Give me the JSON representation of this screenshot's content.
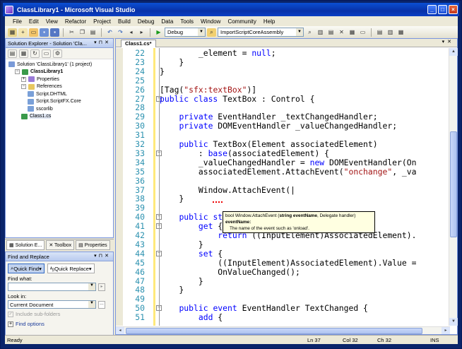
{
  "window": {
    "title": "ClassLibrary1 - Microsoft Visual Studio"
  },
  "menu": [
    "File",
    "Edit",
    "View",
    "Refactor",
    "Project",
    "Build",
    "Debug",
    "Data",
    "Tools",
    "Window",
    "Community",
    "Help"
  ],
  "toolbar": {
    "config": "Debug",
    "project": "ImportScriptCoreAssembly"
  },
  "solution_explorer": {
    "title": "Solution Explorer - Solution 'Cla...",
    "nodes": [
      {
        "label": "Solution 'ClassLibrary1' (1 project)",
        "indent": 0
      },
      {
        "label": "ClassLibrary1",
        "indent": 1,
        "bold": true
      },
      {
        "label": "Properties",
        "indent": 2
      },
      {
        "label": "References",
        "indent": 2
      },
      {
        "label": "Script.DHTML",
        "indent": 3
      },
      {
        "label": "Script.ScriptFX.Core",
        "indent": 3
      },
      {
        "label": "sscorlib",
        "indent": 3
      },
      {
        "label": "Class1.cs",
        "indent": 2
      }
    ]
  },
  "pane_tabs": {
    "tab1": "Solution E...",
    "tab2": "Toolbox",
    "tab3": "Properties"
  },
  "find_replace": {
    "title": "Find and Replace",
    "quick_find": "Quick Find",
    "quick_replace": "Quick Replace",
    "find_what_label": "Find what:",
    "find_what_value": "",
    "look_in_label": "Look in:",
    "look_in_value": "Current Document",
    "include_sub": "Include sub-folders",
    "find_options": "Find options"
  },
  "editor": {
    "tab_label": "Class1.cs*",
    "lines": [
      {
        "n": "22",
        "html": "        _element = <span class=\"kw\">null</span>;"
      },
      {
        "n": "23",
        "html": "    }"
      },
      {
        "n": "24",
        "html": "}"
      },
      {
        "n": "25",
        "html": ""
      },
      {
        "n": "26",
        "html": "[Tag(<span class=\"st\">\"sfx:textBox\"</span>)]"
      },
      {
        "n": "27",
        "html": "<span class=\"kw\">public class</span> TextBox : Control {"
      },
      {
        "n": "28",
        "html": ""
      },
      {
        "n": "29",
        "html": "    <span class=\"kw\">private</span> EventHandler _textChangedHandler;"
      },
      {
        "n": "30",
        "html": "    <span class=\"kw\">private</span> DOMEventHandler _valueChangedHandler;"
      },
      {
        "n": "31",
        "html": ""
      },
      {
        "n": "32",
        "html": "    <span class=\"kw\">public</span> TextBox(Element associatedElement)"
      },
      {
        "n": "33",
        "html": "        : <span class=\"kw\">base</span>(associatedElement) {"
      },
      {
        "n": "34",
        "html": "        _valueChangedHandler = <span class=\"kw\">new</span> DOMEventHandler(On"
      },
      {
        "n": "35",
        "html": "        associatedElement.AttachEvent(<span class=\"st\">\"onchange\"</span>, _va"
      },
      {
        "n": "36",
        "html": ""
      },
      {
        "n": "37",
        "html": "        Window.AttachEvent(|"
      },
      {
        "n": "38",
        "html": "    }"
      },
      {
        "n": "39",
        "html": ""
      },
      {
        "n": "40",
        "html": "    <span class=\"kw\">public string</span> Text {"
      },
      {
        "n": "41",
        "html": "        <span class=\"kw\">get</span> {"
      },
      {
        "n": "42",
        "html": "            <span class=\"kw\">return</span> ((InputElement)AssociatedElement)."
      },
      {
        "n": "43",
        "html": "        }"
      },
      {
        "n": "44",
        "html": "        <span class=\"kw\">set</span> {"
      },
      {
        "n": "45",
        "html": "            ((InputElement)AssociatedElement).Value ="
      },
      {
        "n": "46",
        "html": "            OnValueChanged();"
      },
      {
        "n": "47",
        "html": "        }"
      },
      {
        "n": "48",
        "html": "    }"
      },
      {
        "n": "49",
        "html": ""
      },
      {
        "n": "50",
        "html": "    <span class=\"kw\">public event</span> EventHandler TextChanged {"
      },
      {
        "n": "51",
        "html": "        <span class=\"kw\">add</span> {"
      }
    ]
  },
  "tooltip": {
    "signature_pre": "bool Window.AttachEvent (",
    "signature_bold": "string eventName",
    "signature_post": ", Delegate handler)",
    "param": "eventName:",
    "desc": "The name of the event such as 'onload'."
  },
  "status": {
    "ready": "Ready",
    "ln": "Ln 37",
    "col": "Col 32",
    "ch": "Ch 32",
    "mode": "INS"
  }
}
